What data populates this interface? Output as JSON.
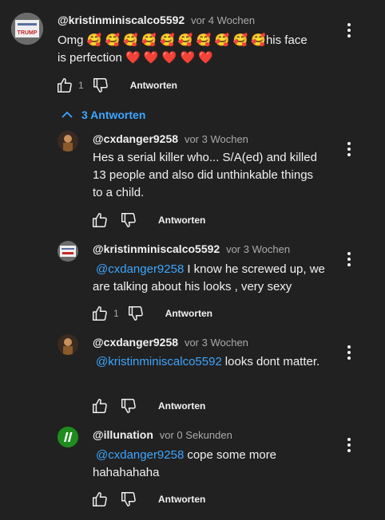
{
  "top_comment": {
    "author": "@kristinminiscalco5592",
    "time": "vor 4 Wochen",
    "text_prefix": "Omg ",
    "emoji_faces": "🥰 🥰 🥰 🥰 🥰 🥰 🥰 🥰 🥰 🥰",
    "text_mid": "his face is perfection ",
    "hearts": "❤️ ❤️ ❤️ ❤️ ❤️",
    "likes": "1",
    "reply_label": "Antworten",
    "avatar_sign_text": "TRUMP"
  },
  "replies_toggle": {
    "label": "3 Antworten"
  },
  "replies": [
    {
      "author": "@cxdanger9258",
      "time": "vor 3 Wochen",
      "text": "Hes a serial killer who... S/A(ed) and killed 13 people and also did unthinkable things to a child.",
      "reply_label": "Antworten"
    },
    {
      "author": "@kristinminiscalco5592",
      "time": "vor 3 Wochen",
      "mention": "@cxdanger9258",
      "text": "I know he screwed up, we are talking about his looks , very sexy",
      "likes": "1",
      "reply_label": "Antworten"
    },
    {
      "author": "@cxdanger9258",
      "time": "vor 3 Wochen",
      "mention": "@kristinminiscalco5592",
      "text": "looks dont matter.",
      "reply_label": "Antworten"
    },
    {
      "author": "@illunation",
      "time": "vor 0 Sekunden",
      "mention": "@cxdanger9258",
      "text": "cope some more hahahahaha",
      "reply_label": "Antworten"
    }
  ],
  "colors": {
    "background": "#212121",
    "link": "#3ea6ff",
    "secondary_text": "#aaaaaa",
    "illunation_avatar": "#1e8c1e"
  }
}
